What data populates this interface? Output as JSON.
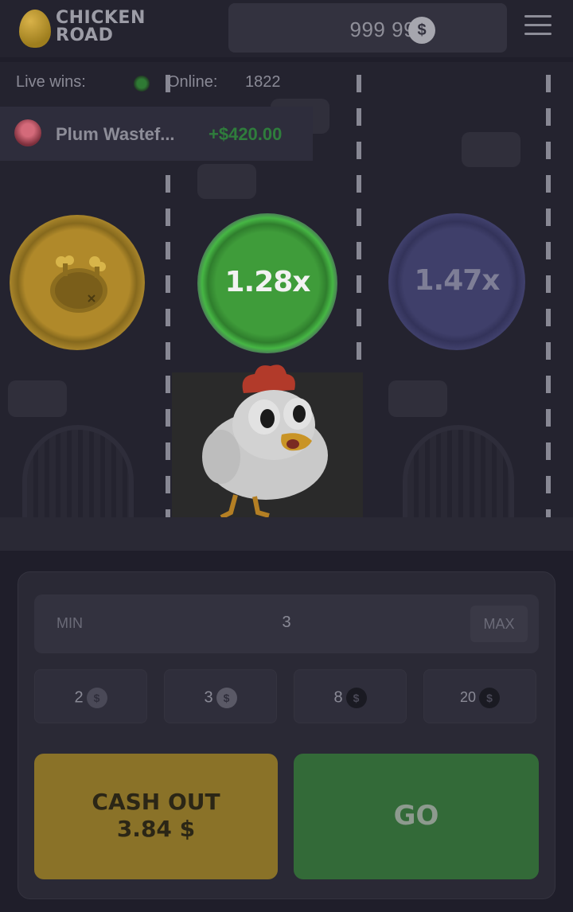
{
  "header": {
    "logo_line1": "CHICKEN",
    "logo_line2": "ROAD",
    "balance": "999 994",
    "currency_symbol": "$"
  },
  "stats": {
    "live_wins_label": "Live wins:",
    "online_label": "Online:",
    "online_count": "1822"
  },
  "live_win": {
    "player_name": "Plum Wastef...",
    "amount": "+$420.00"
  },
  "lanes": [
    {
      "state": "passed",
      "icon": "roast-chicken-icon"
    },
    {
      "state": "current",
      "multiplier": "1.28x"
    },
    {
      "state": "next",
      "multiplier": "1.47x"
    }
  ],
  "bet": {
    "min_label": "MIN",
    "value": "3",
    "max_label": "MAX"
  },
  "quick_bets": [
    {
      "value": "2",
      "coin": "$"
    },
    {
      "value": "3",
      "coin": "$"
    },
    {
      "value": "8",
      "coin": "$"
    },
    {
      "value": "20",
      "coin": "$"
    }
  ],
  "actions": {
    "cashout_label": "CASH OUT",
    "cashout_amount": "3.84 $",
    "go_label": "GO"
  },
  "colors": {
    "background": "#1f1e2a",
    "gold": "#8a7228",
    "green": "#336a38",
    "accent_green": "#46b744"
  }
}
